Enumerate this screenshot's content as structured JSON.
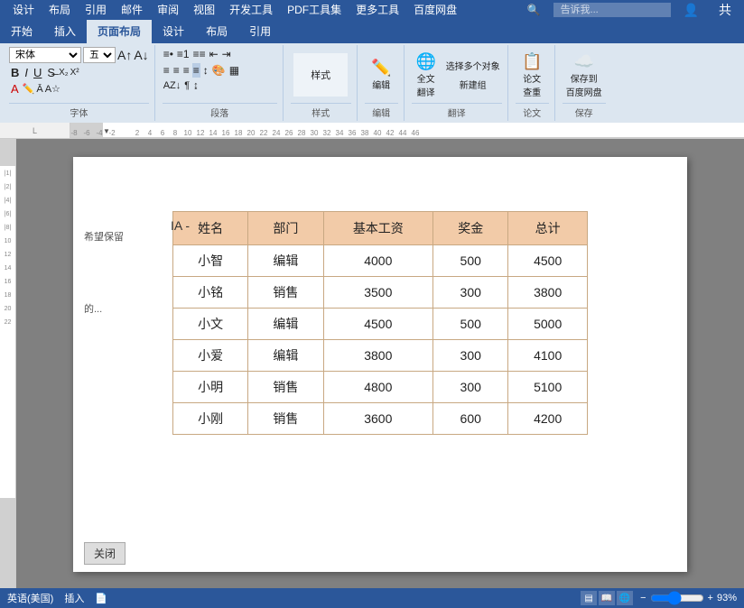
{
  "menu": {
    "items": [
      "设计",
      "布局",
      "引用",
      "邮件",
      "审阅",
      "视图",
      "开发工具",
      "PDF工具集",
      "更多工具",
      "百度网盘"
    ],
    "search_placeholder": "告诉我...",
    "right_icons": [
      "user-icon",
      "share-icon"
    ]
  },
  "ribbon": {
    "tabs": [
      "五号",
      "字体",
      "段落",
      "样式",
      "翻译"
    ],
    "active_tab": "开始",
    "groups": [
      {
        "label": "字体",
        "controls": [
          "font_name",
          "font_size",
          "bold",
          "italic",
          "underline",
          "color"
        ]
      },
      {
        "label": "段落",
        "controls": [
          "align_left",
          "align_center",
          "align_right",
          "justify",
          "list",
          "indent"
        ]
      },
      {
        "label": "样式",
        "controls": []
      },
      {
        "label": "翻译",
        "controls": [
          "全文翻译",
          "编辑",
          "多个对象",
          "新建组"
        ]
      },
      {
        "label": "论文",
        "controls": [
          "论文查重"
        ]
      },
      {
        "label": "保存",
        "controls": [
          "保存到百度网盘"
        ]
      }
    ]
  },
  "table": {
    "headers": [
      "姓名",
      "部门",
      "基本工资",
      "奖金",
      "总计"
    ],
    "rows": [
      [
        "小智",
        "编辑",
        "4000",
        "500",
        "4500"
      ],
      [
        "小铭",
        "销售",
        "3500",
        "300",
        "3800"
      ],
      [
        "小文",
        "编辑",
        "4500",
        "500",
        "5000"
      ],
      [
        "小爱",
        "编辑",
        "3800",
        "300",
        "4100"
      ],
      [
        "小明",
        "销售",
        "4800",
        "300",
        "5100"
      ],
      [
        "小刚",
        "销售",
        "3600",
        "600",
        "4200"
      ]
    ]
  },
  "sidebar_left": {
    "text_lines": [
      "希望保留",
      "的..."
    ]
  },
  "status_bar": {
    "lang": "英语(美国)",
    "mode": "插入",
    "icon": "📄",
    "zoom": "93%",
    "close_btn": "关闭"
  },
  "ruler": {
    "numbers": [
      "-8",
      "-6",
      "-4",
      "-2",
      "2",
      "4",
      "6",
      "8",
      "10",
      "12",
      "14",
      "16",
      "18",
      "20",
      "22",
      "24",
      "26",
      "28",
      "30",
      "32",
      "34",
      "36",
      "38",
      "40",
      "42",
      "44",
      "46"
    ]
  }
}
